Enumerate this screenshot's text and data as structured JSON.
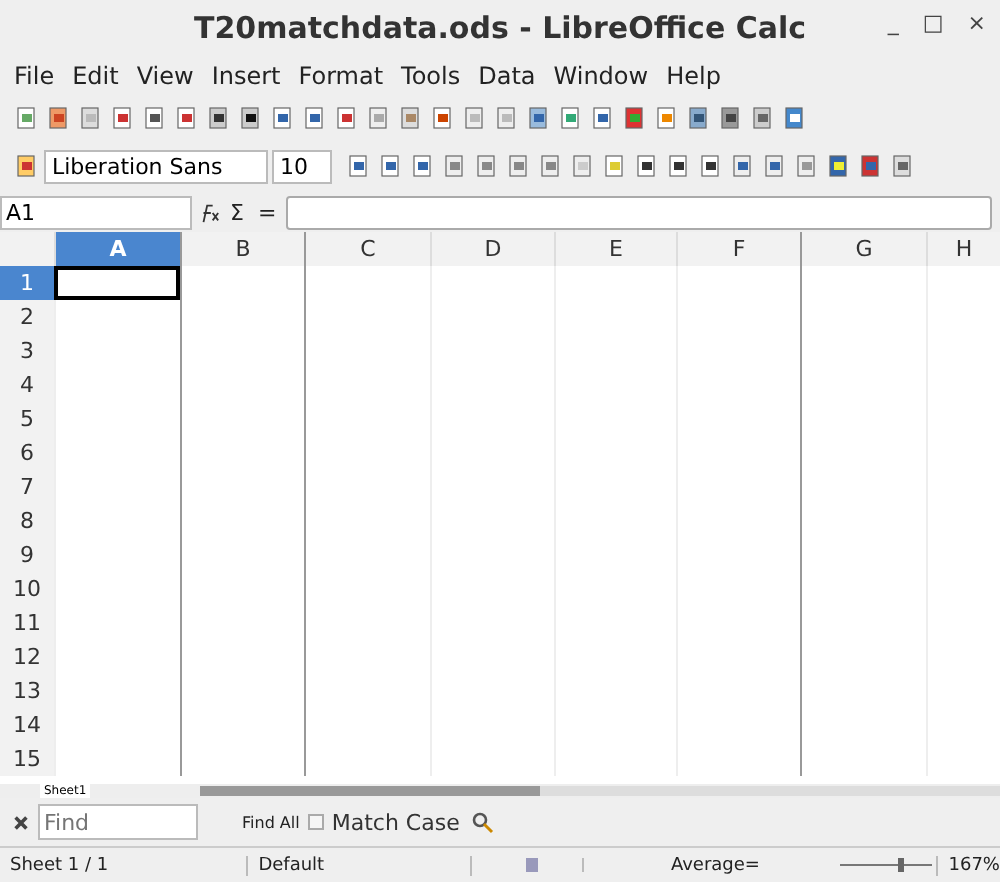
{
  "window": {
    "title": "T20matchdata.ods - LibreOffice Calc",
    "controls": [
      "_",
      "□",
      "×"
    ]
  },
  "menu": [
    {
      "label": "File"
    },
    {
      "label": "Edit"
    },
    {
      "label": "View"
    },
    {
      "label": "Insert"
    },
    {
      "label": "Format"
    },
    {
      "label": "Tools"
    },
    {
      "label": "Data"
    },
    {
      "label": "Window"
    },
    {
      "label": "Help"
    }
  ],
  "formatting": {
    "font_name": "Liberation Sans",
    "font_size": "10"
  },
  "formula_bar": {
    "name_box": "A1",
    "sum": "Σ",
    "equals": "="
  },
  "columns": [
    {
      "label": "A",
      "selected": true,
      "page_break": false
    },
    {
      "label": "B",
      "selected": false,
      "page_break": true
    },
    {
      "label": "C",
      "selected": false,
      "page_break": true
    },
    {
      "label": "D",
      "selected": false,
      "page_break": false
    },
    {
      "label": "E",
      "selected": false,
      "page_break": false
    },
    {
      "label": "F",
      "selected": false,
      "page_break": false
    },
    {
      "label": "G",
      "selected": false,
      "page_break": true
    },
    {
      "label": "H",
      "selected": false,
      "page_break": false
    }
  ],
  "rows": [
    {
      "label": "1",
      "selected": true
    },
    {
      "label": "2",
      "selected": false
    },
    {
      "label": "3",
      "selected": false
    },
    {
      "label": "4",
      "selected": false
    },
    {
      "label": "5",
      "selected": false
    },
    {
      "label": "6",
      "selected": false
    },
    {
      "label": "7",
      "selected": false
    },
    {
      "label": "8",
      "selected": false
    },
    {
      "label": "9",
      "selected": false
    },
    {
      "label": "10",
      "selected": false
    },
    {
      "label": "11",
      "selected": false
    },
    {
      "label": "12",
      "selected": false
    },
    {
      "label": "13",
      "selected": false
    },
    {
      "label": "14",
      "selected": false
    },
    {
      "label": "15",
      "selected": false
    }
  ],
  "sheet_tabs": [
    {
      "label": "Sheet1",
      "selected": true
    }
  ],
  "find_bar": {
    "placeholder": "Find",
    "find_all": "Find All",
    "match_case": {
      "label": "Match Case",
      "checked": false
    }
  },
  "status_bar": {
    "sheet": "Sheet 1 / 1",
    "style": "Default",
    "summary": "Average=",
    "zoom": "167%",
    "zoom_slider": {
      "level": 0.62
    }
  }
}
